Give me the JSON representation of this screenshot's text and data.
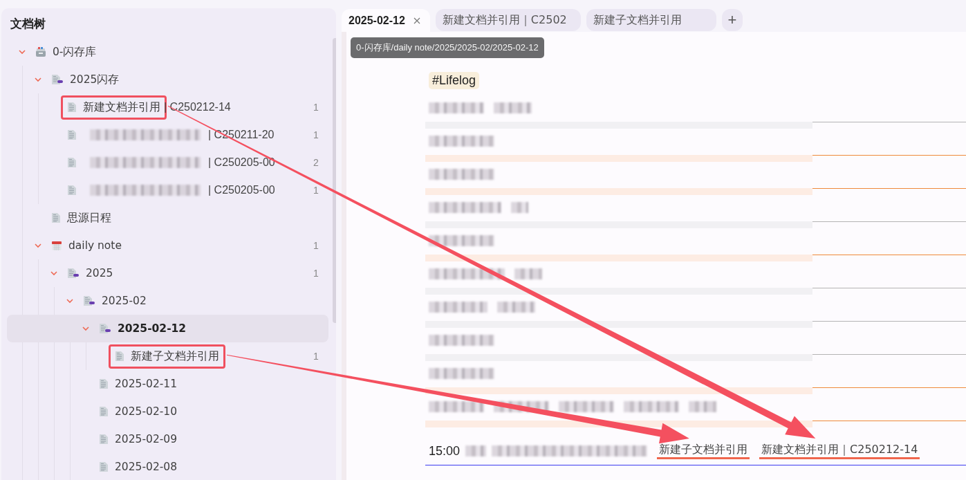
{
  "sidebar": {
    "title": "文档树",
    "tree": [
      {
        "name": "0-闪存库",
        "kind": "box",
        "expanded": true,
        "selected": false,
        "children": [
          {
            "name": "2025闪存",
            "kind": "folder-doc",
            "expanded": true,
            "selected": false,
            "children": [
              {
                "name": "新建文档并引用",
                "suffix": "| C250212-14",
                "kind": "doc",
                "count": "1",
                "selected": false,
                "highlighted": true,
                "arrow": true
              },
              {
                "blurred": true,
                "suffix": "| C250211-20",
                "kind": "doc",
                "count": "1",
                "selected": false
              },
              {
                "blurred": true,
                "suffix": "| C250205-00",
                "kind": "doc",
                "count": "2",
                "selected": false
              },
              {
                "blurred": true,
                "suffix": "| C250205-00",
                "kind": "doc",
                "count": "1",
                "selected": false
              }
            ]
          },
          {
            "name": "思源日程",
            "kind": "doc",
            "selected": false
          },
          {
            "name": "daily note",
            "kind": "calendar",
            "count": "1",
            "expanded": true,
            "selected": false,
            "children": [
              {
                "name": "2025",
                "kind": "folder-doc",
                "count": "1",
                "expanded": true,
                "selected": false,
                "children": [
                  {
                    "name": "2025-02",
                    "kind": "folder-doc",
                    "expanded": true,
                    "selected": false,
                    "children": [
                      {
                        "name": "2025-02-12",
                        "kind": "folder-doc",
                        "expanded": true,
                        "selected": true,
                        "children": [
                          {
                            "name": "新建子文档并引用",
                            "kind": "doc",
                            "count": "1",
                            "selected": false,
                            "highlighted": true,
                            "arrow": true
                          }
                        ]
                      },
                      {
                        "name": "2025-02-11",
                        "kind": "doc",
                        "selected": false
                      },
                      {
                        "name": "2025-02-10",
                        "kind": "doc",
                        "selected": false
                      },
                      {
                        "name": "2025-02-09",
                        "kind": "doc",
                        "selected": false
                      },
                      {
                        "name": "2025-02-08",
                        "kind": "doc",
                        "selected": false
                      }
                    ]
                  }
                ]
              }
            ]
          }
        ]
      }
    ]
  },
  "tabs": [
    {
      "label": "2025-02-12",
      "selected": true,
      "closable": true
    },
    {
      "label": "新建文档并引用｜C2502",
      "selected": false
    },
    {
      "label": "新建子文档并引用",
      "selected": false
    }
  ],
  "new_tab": "+",
  "tooltip": "0-闪存库/daily note/2025/2025-02/2025-02-12",
  "editor": {
    "tag": "#Lifelog",
    "rows": [
      {
        "color": "#b4b4b4"
      },
      {
        "color": "#ef8a3a"
      },
      {
        "color": "#ef8a3a"
      },
      {
        "color": "#b4b4b4"
      },
      {
        "color": "#ef8a3a"
      },
      {
        "color": "#b4b4b4"
      },
      {
        "color": "#b4b4b4"
      },
      {
        "color": "#b4b4b4"
      },
      {
        "color": "#ef8a3a"
      },
      {
        "color": "#ef8a3a"
      }
    ],
    "last_line": {
      "time": "15:00",
      "refs": [
        {
          "text": "新建子文档并引用",
          "arrow": true
        },
        {
          "text": "新建文档并引用｜C250212-14",
          "arrow": true
        }
      ]
    }
  }
}
